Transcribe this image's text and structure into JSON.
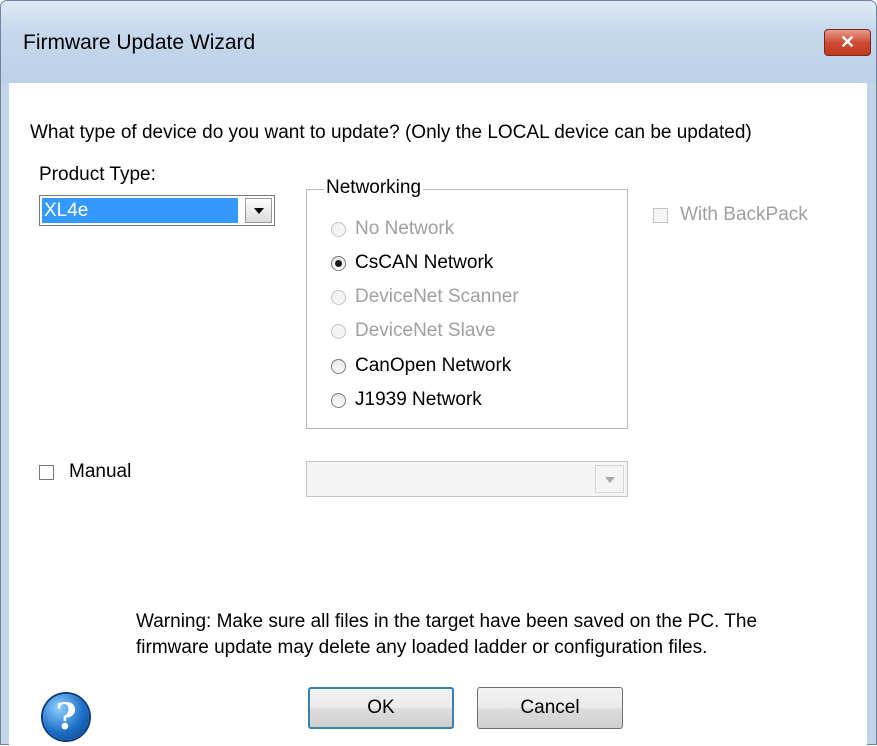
{
  "window": {
    "title": "Firmware Update Wizard",
    "close_glyph": "✕"
  },
  "prompt": "What type of device do you want to update? (Only the LOCAL device can be updated)",
  "product_type": {
    "label": "Product Type:",
    "selected": "XL4e"
  },
  "networking": {
    "label": "Networking",
    "options": [
      {
        "label": "No Network",
        "enabled": false,
        "selected": false
      },
      {
        "label": "CsCAN Network",
        "enabled": true,
        "selected": true
      },
      {
        "label": "DeviceNet Scanner",
        "enabled": false,
        "selected": false
      },
      {
        "label": "DeviceNet Slave",
        "enabled": false,
        "selected": false
      },
      {
        "label": "CanOpen Network",
        "enabled": true,
        "selected": false
      },
      {
        "label": "J1939 Network",
        "enabled": true,
        "selected": false
      }
    ]
  },
  "backpack": {
    "label": "With BackPack",
    "checked": false,
    "enabled": false
  },
  "manual": {
    "label": "Manual",
    "checked": false,
    "enabled": true
  },
  "manual_combo": {
    "value": "",
    "enabled": false
  },
  "warning": {
    "line1": "Warning:  Make sure all files in the target have been saved on the PC.  The",
    "line2": "firmware update may delete any loaded ladder or configuration files.",
    "icon": "question-icon"
  },
  "buttons": {
    "ok": "OK",
    "cancel": "Cancel"
  },
  "colors": {
    "selection": "#3399ff",
    "close_button": "#c0381f",
    "disabled_text": "#a0a0a0"
  }
}
